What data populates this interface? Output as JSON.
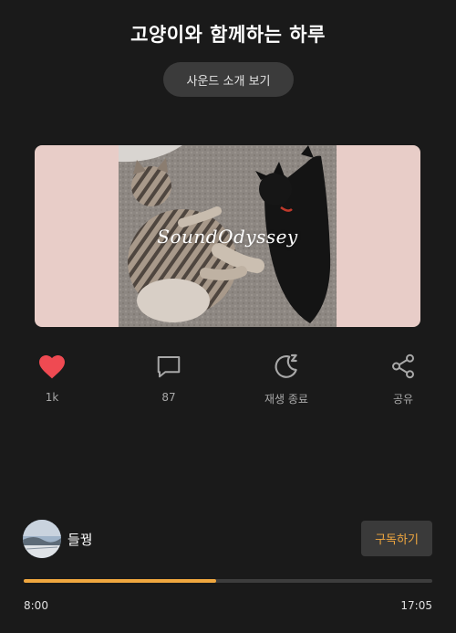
{
  "header": {
    "title": "고양이와 함께하는 하루",
    "intro_button": "사운드 소개 보기"
  },
  "media": {
    "watermark": "SoundOdyssey"
  },
  "actions": {
    "like": {
      "icon": "heart-icon",
      "label": "1k",
      "color": "#ef4a52"
    },
    "comment": {
      "icon": "comment-icon",
      "label": "87"
    },
    "sleep_timer": {
      "icon": "moon-icon",
      "label": "재생 종료"
    },
    "share": {
      "icon": "share-icon",
      "label": "공유"
    }
  },
  "channel": {
    "name": "들꿩",
    "subscribe_label": "구독하기"
  },
  "player": {
    "elapsed": "8:00",
    "total": "17:05",
    "progress": 0.47,
    "accent_color": "#f0a73f"
  }
}
